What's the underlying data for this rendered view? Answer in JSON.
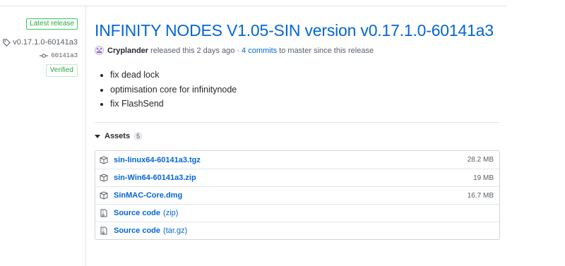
{
  "sidebar": {
    "latest_badge": "Latest release",
    "tag": "v0.17.1.0-60141a3",
    "commit": "60141a3",
    "verified": "Verified"
  },
  "release": {
    "title": "INFINITY NODES V1.05-SIN version v0.17.1.0-60141a3",
    "author": "Cryplander",
    "byline_mid": "released this 2 days ago ·",
    "commits_link": "4 commits",
    "byline_end": "to master since this release",
    "notes": [
      "fix dead lock",
      "optimisation core for infinitynode",
      "fix FlashSend"
    ]
  },
  "assets": {
    "heading": "Assets",
    "count": "5",
    "files": [
      {
        "name": "sin-linux64-60141a3.tgz",
        "size": "28.2 MB",
        "icon": "package-icon"
      },
      {
        "name": "sin-Win64-60141a3.zip",
        "size": "19 MB",
        "icon": "package-icon"
      },
      {
        "name": "SinMAC-Core.dmg",
        "size": "16.7 MB",
        "icon": "package-icon"
      }
    ],
    "sources": [
      {
        "name": "Source code",
        "format": "(zip)",
        "icon": "file-zip-icon"
      },
      {
        "name": "Source code",
        "format": "(tar.gz)",
        "icon": "file-zip-icon"
      }
    ]
  },
  "colors": {
    "link": "#0366d6",
    "verified": "#28a745",
    "text": "#24292e",
    "muted": "#586069"
  }
}
